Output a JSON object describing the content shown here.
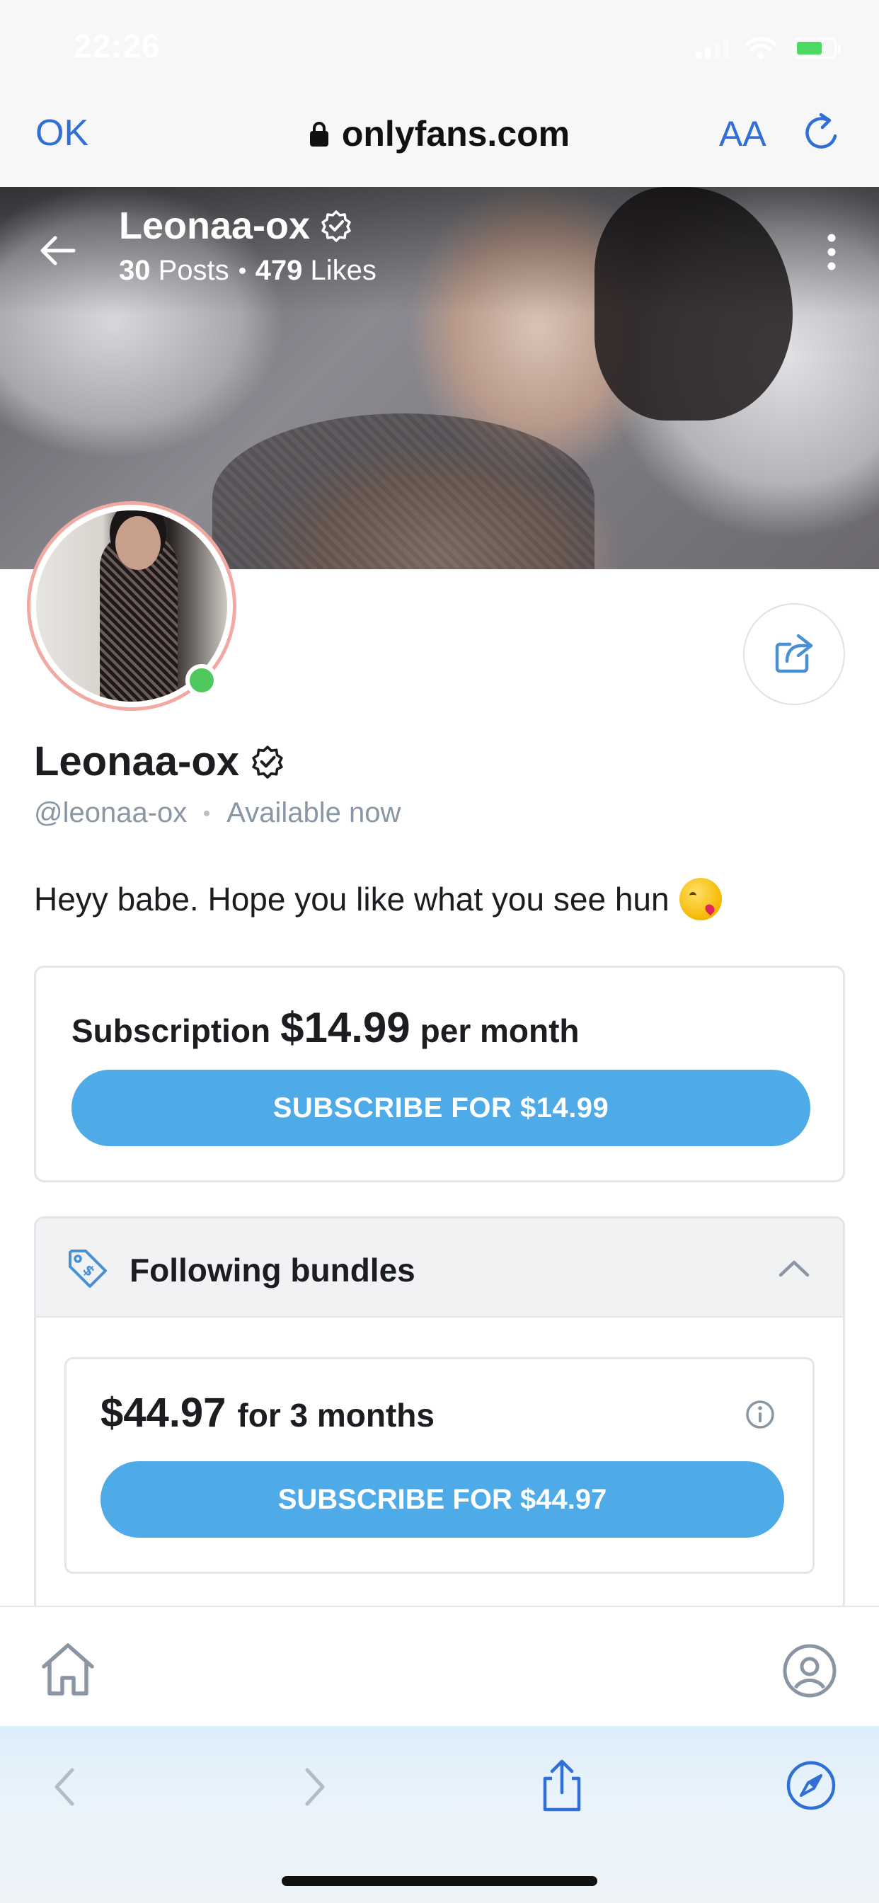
{
  "status_bar": {
    "time": "22:26",
    "icons": [
      "signal-icon",
      "wifi-icon",
      "battery-charging-icon"
    ]
  },
  "browser": {
    "done_label": "OK",
    "url": "onlyfans.com",
    "text_size_label": "AA",
    "icons": [
      "lock-icon",
      "reload-icon"
    ],
    "accent_color": "#2f6fd6"
  },
  "cover": {
    "name": "Leonaa-ox",
    "posts_count": "30",
    "posts_label": "Posts",
    "likes_count": "479",
    "likes_label": "Likes",
    "icons": [
      "back-arrow-icon",
      "verified-icon",
      "more-vertical-icon"
    ]
  },
  "profile": {
    "name": "Leonaa-ox",
    "handle": "@leonaa-ox",
    "availability": "Available now",
    "bio": "Heyy babe. Hope you like what you see hun",
    "online_color": "#4fc95b",
    "icons": [
      "verified-icon",
      "share-icon",
      "kissing-face-emoji-icon"
    ]
  },
  "subscription": {
    "label": "Subscription",
    "price": "$14.99",
    "period": "per month",
    "button_label": "SUBSCRIBE FOR $14.99",
    "button_color": "#4faae8"
  },
  "bundles": {
    "title": "Following bundles",
    "icons": [
      "price-tag-icon",
      "chevron-up-icon",
      "info-icon"
    ],
    "items": [
      {
        "price": "$44.97",
        "duration": "for 3 months",
        "button_label": "SUBSCRIBE FOR $44.97"
      }
    ]
  },
  "app_nav": {
    "icons": [
      "home-icon",
      "profile-icon"
    ]
  },
  "safari_toolbar": {
    "icons": [
      "back-icon",
      "forward-icon",
      "share-icon",
      "compass-icon"
    ]
  }
}
